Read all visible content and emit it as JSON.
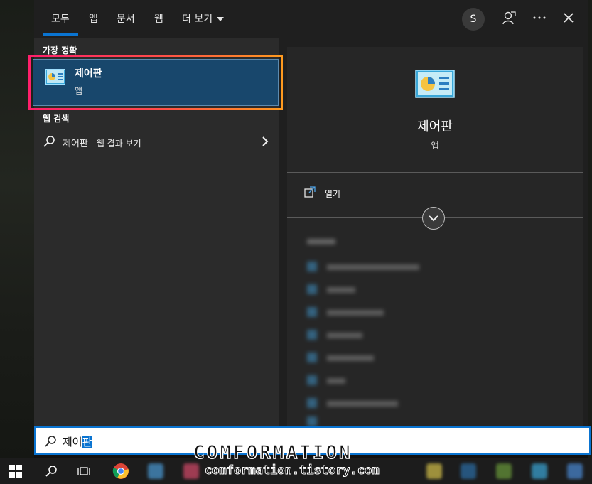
{
  "tabs": [
    {
      "label": "모두",
      "active": true
    },
    {
      "label": "앱"
    },
    {
      "label": "문서"
    },
    {
      "label": "웹"
    },
    {
      "label": "더 보기"
    }
  ],
  "header": {
    "avatar_initial": "S",
    "icons": [
      "feedback-icon",
      "more-icon",
      "close-icon"
    ]
  },
  "best_match": {
    "section_label": "가장 정확",
    "title": "제어판",
    "subtitle": "앱",
    "icon": "control-panel-icon"
  },
  "web_search": {
    "section_label": "웹 검색",
    "query": "제어판",
    "suffix": " - 웹 결과 보기"
  },
  "detail": {
    "title": "제어판",
    "subtitle": "앱",
    "open_label": "열기"
  },
  "search": {
    "typed": "제어",
    "selected": "판"
  },
  "watermark": {
    "line1": "COMFORMATION",
    "line2": "comformation.tistory.com"
  },
  "colors": {
    "accent": "#0a74d1",
    "best_match_bg": "#18476c"
  }
}
